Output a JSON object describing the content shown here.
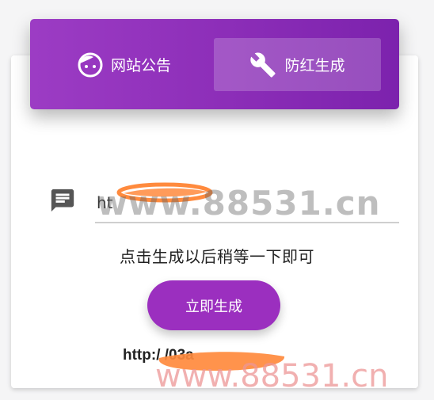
{
  "tabs": [
    {
      "label": "网站公告",
      "icon": "face-icon"
    },
    {
      "label": "防红生成",
      "icon": "wrench-icon",
      "active": true
    }
  ],
  "url_input": {
    "value": "ht"
  },
  "hint_text": "点击生成以后稍等一下即可",
  "generate_button_label": "立即生成",
  "result_link_text": "http:/                  /03a",
  "watermark_text": "www.88531.cn",
  "colors": {
    "primary": "#9b2fbf",
    "header_start": "#9c3cc4",
    "header_end": "#7c22ad",
    "scribble": "#ff8a3d"
  }
}
